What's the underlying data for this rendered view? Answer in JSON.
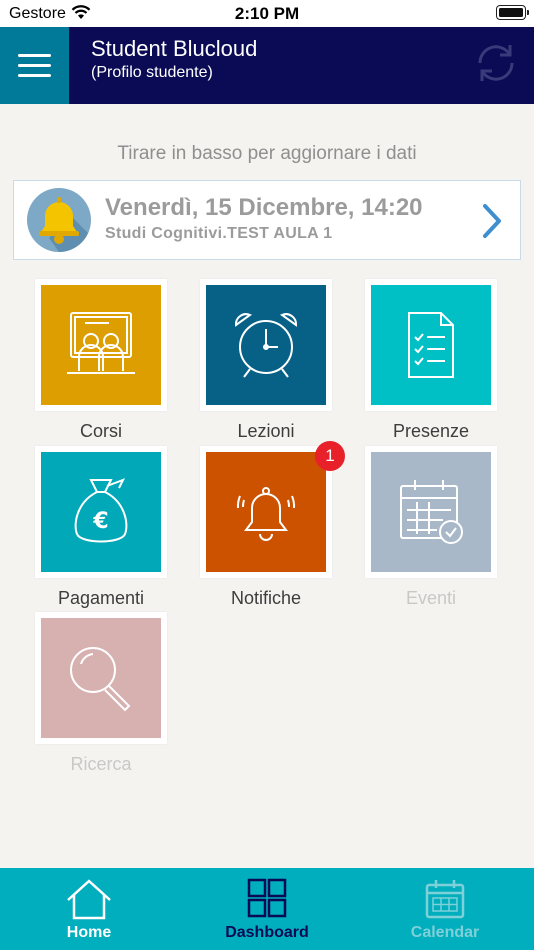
{
  "status_bar": {
    "carrier": "Gestore",
    "time": "2:10 PM"
  },
  "header": {
    "title": "Student Blucloud",
    "subtitle": "(Profilo studente)"
  },
  "hint": "Tirare in basso per aggiornare i dati",
  "next_event": {
    "date": "Venerdì, 15 Dicembre, 14:20",
    "place": "Studi Cognitivi.TEST AULA 1"
  },
  "tiles": [
    {
      "label": "Corsi",
      "color": "#dc9e00",
      "icon": "classroom-icon",
      "enabled": true
    },
    {
      "label": "Lezioni",
      "color": "#076187",
      "icon": "alarm-clock-icon",
      "enabled": true
    },
    {
      "label": "Presenze",
      "color": "#00c0c5",
      "icon": "checklist-icon",
      "enabled": true
    },
    {
      "label": "Pagamenti",
      "color": "#00a8b8",
      "icon": "money-bag-icon",
      "enabled": true
    },
    {
      "label": "Notifiche",
      "color": "#cc5200",
      "icon": "bell-icon",
      "enabled": true,
      "badge": "1"
    },
    {
      "label": "Eventi",
      "color": "#a9b8c9",
      "icon": "calendar-check-icon",
      "enabled": false
    },
    {
      "label": "Ricerca",
      "color": "#d7b0b0",
      "icon": "magnifier-icon",
      "enabled": false
    }
  ],
  "tabbar": [
    {
      "label": "Home",
      "icon": "home-icon",
      "color": "#ffffff",
      "active": false
    },
    {
      "label": "Dashboard",
      "icon": "grid-icon",
      "color": "#0b0b55",
      "active": true
    },
    {
      "label": "Calendar",
      "icon": "calendar-icon",
      "color": "#7ed0d9",
      "active": false
    }
  ]
}
